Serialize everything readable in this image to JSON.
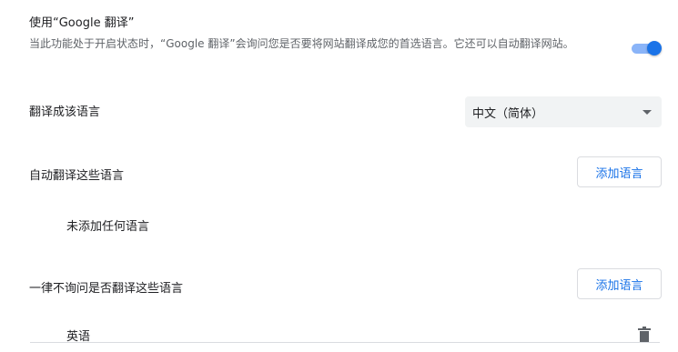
{
  "google_translate": {
    "title": "使用“Google 翻译”",
    "description": "当此功能处于开启状态时，“Google 翻译”会询问您是否要将网站翻译成您的首选语言。它还可以自动翻译网站。",
    "enabled": true
  },
  "translate_to": {
    "label": "翻译成该语言",
    "selected": "中文（简体）"
  },
  "auto_translate": {
    "label": "自动翻译这些语言",
    "add_button": "添加语言",
    "empty_text": "未添加任何语言"
  },
  "never_ask": {
    "label": "一律不询问是否翻译这些语言",
    "add_button": "添加语言",
    "languages": [
      "英语"
    ]
  },
  "colors": {
    "accent": "#1a73e8",
    "toggle_track": "#8ab4f8",
    "select_bg": "#f1f3f4",
    "border": "#dadce0"
  }
}
